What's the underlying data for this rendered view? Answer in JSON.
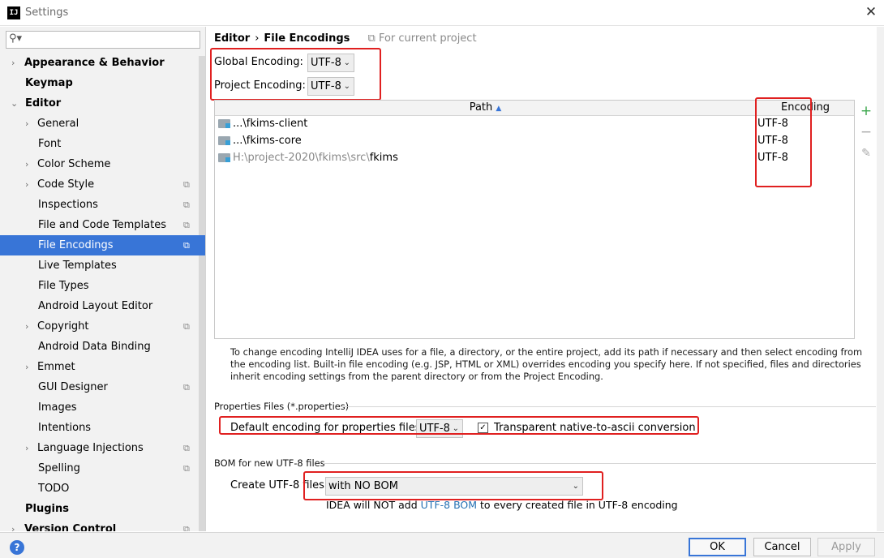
{
  "window": {
    "title": "Settings",
    "app_icon_text": "IJ"
  },
  "search": {
    "placeholder": "",
    "icon": "search-icon"
  },
  "sidebar": {
    "items": [
      {
        "label": "Appearance & Behavior",
        "arrow": "›"
      },
      {
        "label": "Keymap"
      },
      {
        "label": "Editor",
        "arrow": "⌄"
      },
      {
        "label": "General",
        "arrow": "›"
      },
      {
        "label": "Font"
      },
      {
        "label": "Color Scheme",
        "arrow": "›"
      },
      {
        "label": "Code Style",
        "arrow": "›",
        "project": "⧉"
      },
      {
        "label": "Inspections",
        "project": "⧉"
      },
      {
        "label": "File and Code Templates",
        "project": "⧉"
      },
      {
        "label": "File Encodings",
        "project": "⧉"
      },
      {
        "label": "Live Templates"
      },
      {
        "label": "File Types"
      },
      {
        "label": "Android Layout Editor"
      },
      {
        "label": "Copyright",
        "arrow": "›",
        "project": "⧉"
      },
      {
        "label": "Android Data Binding"
      },
      {
        "label": "Emmet",
        "arrow": "›"
      },
      {
        "label": "GUI Designer",
        "project": "⧉"
      },
      {
        "label": "Images"
      },
      {
        "label": "Intentions"
      },
      {
        "label": "Language Injections",
        "arrow": "›",
        "project": "⧉"
      },
      {
        "label": "Spelling",
        "project": "⧉"
      },
      {
        "label": "TODO"
      },
      {
        "label": "Plugins"
      },
      {
        "label": "Version Control",
        "arrow": "›",
        "project": "⧉"
      }
    ],
    "selected": "File Encodings"
  },
  "breadcrumb": {
    "part1": "Editor",
    "sep": "›",
    "part2": "File Encodings",
    "note_icon": "⧉",
    "note": "For current project"
  },
  "global_encoding": {
    "label": "Global Encoding:",
    "value": "UTF-8"
  },
  "project_encoding": {
    "label": "Project Encoding:",
    "value": "UTF-8"
  },
  "table": {
    "col_path": "Path",
    "col_path_sort": "▲",
    "col_encoding": "Encoding",
    "rows": [
      {
        "prefix": "...\\",
        "name": "fkims-client",
        "encoding": "UTF-8"
      },
      {
        "prefix": "...\\",
        "name": "fkims-core",
        "encoding": "UTF-8"
      },
      {
        "prefix": "H:\\project-2020\\fkims\\src\\",
        "name": "fkims",
        "encoding": "UTF-8"
      }
    ]
  },
  "tools": {
    "add": "+",
    "remove": "−",
    "edit": "✎"
  },
  "help_text": "To change encoding IntelliJ IDEA uses for a file, a directory, or the entire project, add its path if necessary and then select encoding from the encoding list. Built-in file encoding (e.g. JSP, HTML or XML) overrides encoding you specify here. If not specified, files and directories inherit encoding settings from the parent directory or from the Project Encoding.",
  "properties": {
    "section_title": "Properties Files (*.properties)",
    "default_label": "Default encoding for properties files:",
    "default_value": "UTF-8",
    "transparent_checked": true,
    "transparent_label": "Transparent native-to-ascii conversion"
  },
  "bom": {
    "section_title": "BOM for new UTF-8 files",
    "create_label": "Create UTF-8 files:",
    "create_value": "with NO BOM",
    "note_pre": "IDEA will NOT add ",
    "note_link": "UTF-8 BOM",
    "note_post": " to every created file in UTF-8 encoding"
  },
  "buttons": {
    "help": "?",
    "ok": "OK",
    "cancel": "Cancel",
    "apply": "Apply"
  },
  "colors": {
    "accent": "#3875d7",
    "highlight": "#e02020",
    "link": "#2470b3"
  }
}
